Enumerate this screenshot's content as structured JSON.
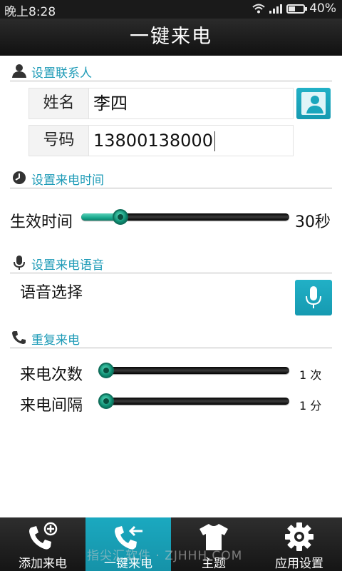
{
  "status_bar": {
    "time": "晚上8:28",
    "battery": "40%"
  },
  "title": "一键来电",
  "contact_section": {
    "title": "设置联系人",
    "name_label": "姓名",
    "name_value": "李四",
    "number_label": "号码",
    "number_value": "13800138000"
  },
  "time_section": {
    "title": "设置来电时间",
    "label": "生效时间",
    "value_text": "30秒",
    "slider_fraction": 0.19
  },
  "voice_section": {
    "title": "设置来电语音",
    "label": "语音选择"
  },
  "repeat_section": {
    "title": "重复来电",
    "count_label": "来电次数",
    "count_value": "1 次",
    "count_fraction": 0.0,
    "interval_label": "来电间隔",
    "interval_value": "1 分",
    "interval_fraction": 0.0
  },
  "nav": {
    "tabs": [
      {
        "label": "添加来电",
        "icon": "phone-add-icon"
      },
      {
        "label": "一键来电",
        "icon": "phone-back-icon"
      },
      {
        "label": "主题",
        "icon": "tshirt-icon"
      },
      {
        "label": "应用设置",
        "icon": "gear-icon"
      }
    ]
  },
  "watermark": "指尖汇软件 · ZJHHH.COM",
  "colors": {
    "accent": "#1e9bb7",
    "active_tab": "#1ba9c0",
    "slider_fill": "#18a98d"
  }
}
